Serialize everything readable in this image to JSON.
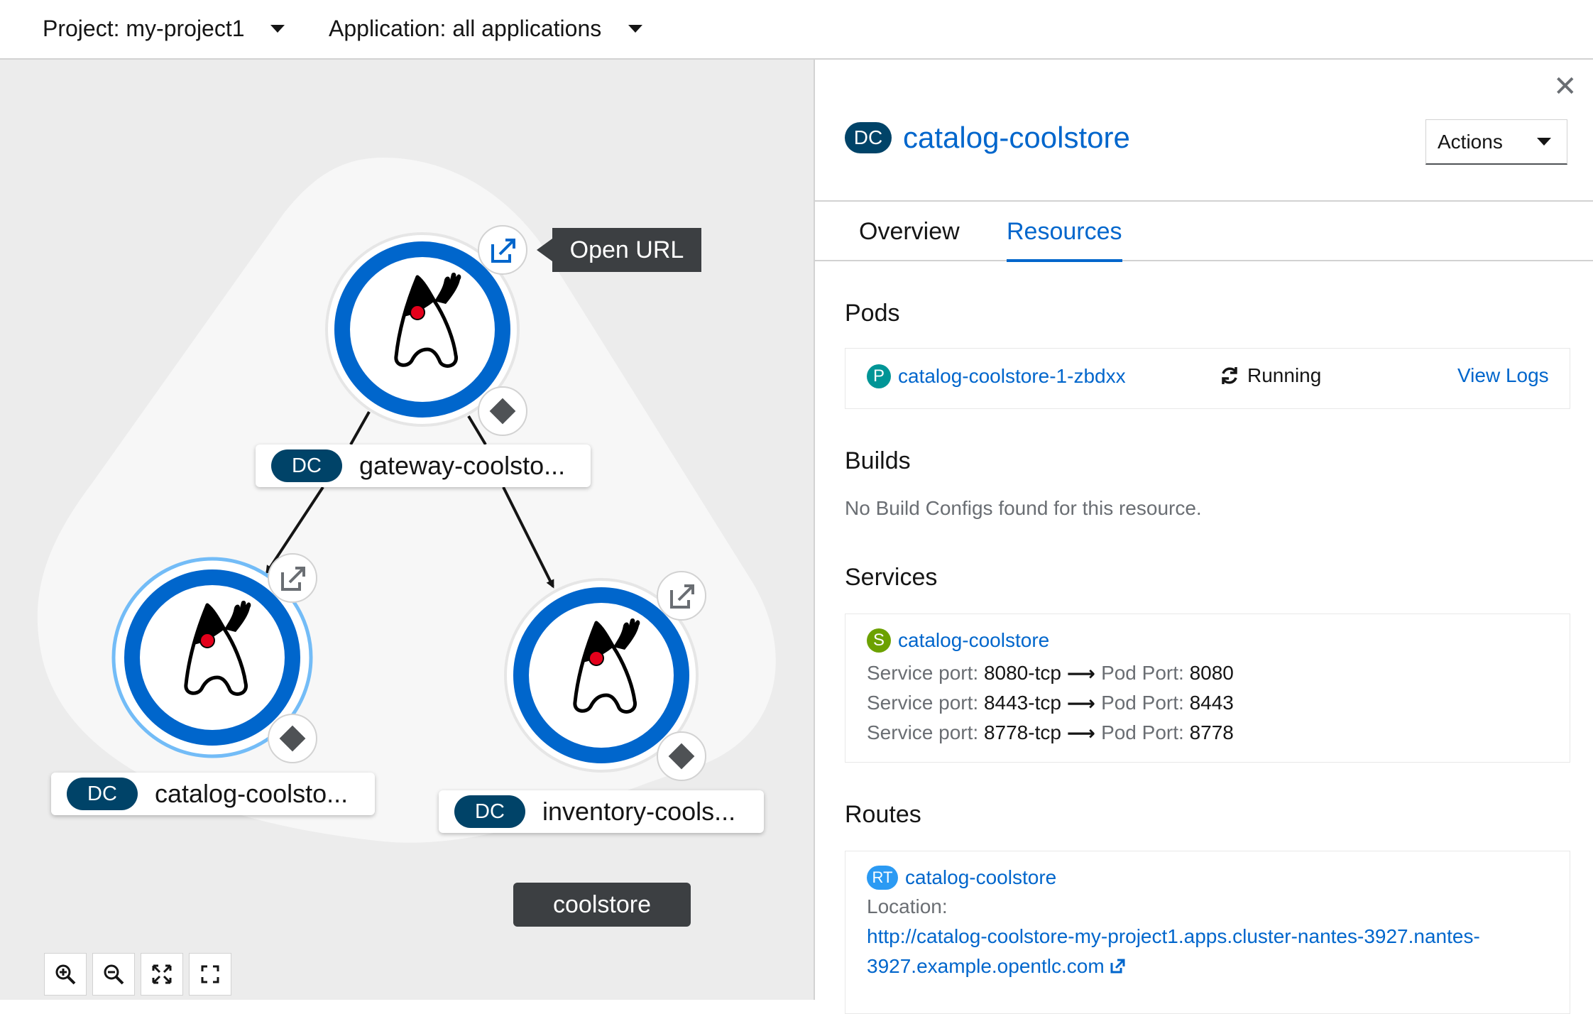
{
  "topbar": {
    "project_label": "Project: my-project1",
    "application_label": "Application: all applications"
  },
  "topology": {
    "tooltip": "Open URL",
    "group_name": "coolstore",
    "nodes": [
      {
        "badge": "DC",
        "label": "gateway-coolsto..."
      },
      {
        "badge": "DC",
        "label": "catalog-coolsto..."
      },
      {
        "badge": "DC",
        "label": "inventory-cools..."
      }
    ],
    "zoom_controls": [
      "zoom-in-icon",
      "zoom-out-icon",
      "fit-to-screen-icon",
      "expand-icon"
    ]
  },
  "panel": {
    "badge": "DC",
    "title": "catalog-coolstore",
    "actions_label": "Actions",
    "tabs": [
      "Overview",
      "Resources"
    ],
    "active_tab": "Resources",
    "pods": {
      "heading": "Pods",
      "badge": "P",
      "name": "catalog-coolstore-1-zbdxx",
      "status": "Running",
      "logs_link": "View Logs"
    },
    "builds": {
      "heading": "Builds",
      "empty_text": "No Build Configs found for this resource."
    },
    "services": {
      "heading": "Services",
      "badge": "S",
      "name": "catalog-coolstore",
      "service_port_label": "Service port:",
      "pod_port_label": "Pod Port:",
      "ports": [
        {
          "service_port": "8080-tcp",
          "pod_port": "8080"
        },
        {
          "service_port": "8443-tcp",
          "pod_port": "8443"
        },
        {
          "service_port": "8778-tcp",
          "pod_port": "8778"
        }
      ]
    },
    "routes": {
      "heading": "Routes",
      "badge": "RT",
      "name": "catalog-coolstore",
      "location_label": "Location:",
      "url_line1": "http://catalog-coolstore-my-project1.apps.cluster-nantes-3927.nantes-",
      "url_line2": "3927.example.opentlc.com"
    }
  },
  "colors": {
    "accent": "#0066cc",
    "dc_badge": "#004368",
    "pod_badge": "#009596",
    "service_badge": "#6ca100",
    "route_badge": "#2b9af3",
    "tooltip_bg": "#3c3f42"
  }
}
